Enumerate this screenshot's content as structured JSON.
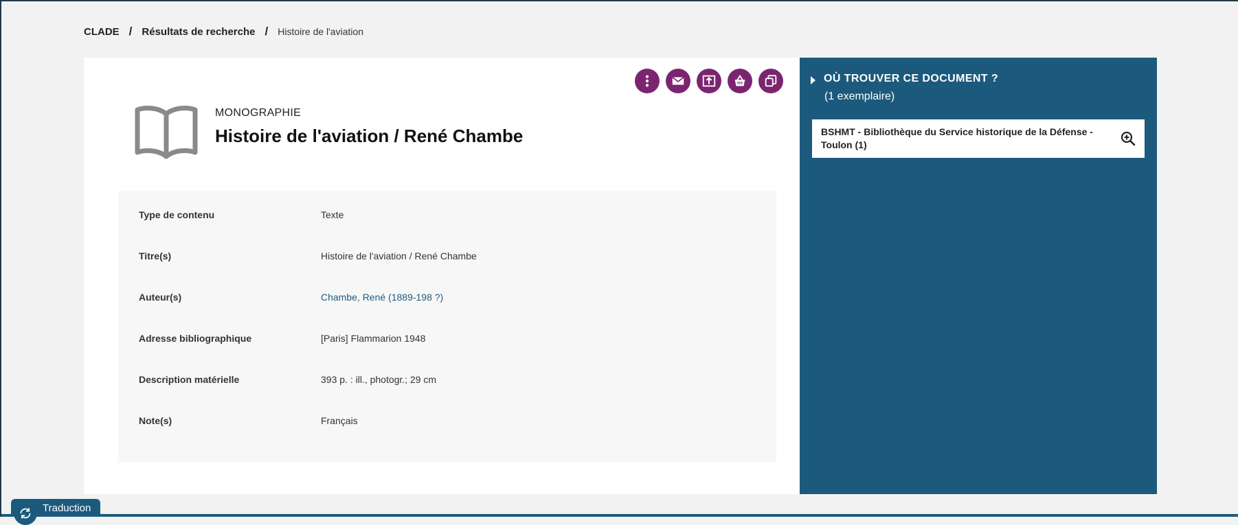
{
  "breadcrumb": {
    "home": "CLADE",
    "separator": "/",
    "results": "Résultats de recherche",
    "current": "Histoire de l'aviation"
  },
  "record": {
    "type": "MONOGRAPHIE",
    "title": "Histoire de l'aviation / René Chambe",
    "icon": "book-icon",
    "actions": [
      "more-options-icon",
      "email-icon",
      "export-icon",
      "basket-icon",
      "copy-icon"
    ]
  },
  "details": [
    {
      "label": "Type de contenu",
      "value": "Texte"
    },
    {
      "label": "Titre(s)",
      "value": "Histoire de l'aviation / René Chambe"
    },
    {
      "label": "Auteur(s)",
      "value": "Chambe, René (1889-198 ?)"
    },
    {
      "label": "Adresse bibliographique",
      "value": "[Paris] Flammarion 1948"
    },
    {
      "label": "Description matérielle",
      "value": "393 p. : ill., photogr.; 29 cm"
    },
    {
      "label": "Note(s)",
      "value": "Français"
    }
  ],
  "availability": {
    "heading": "OÙ TROUVER CE DOCUMENT ?",
    "count": "(1 exemplaire)",
    "location": "BSHMT - Bibliothèque du Service historique de la Défense - Toulon (1)"
  },
  "footer": {
    "translate_label": "Traduction"
  },
  "colors": {
    "accent": "#7b2470",
    "panel": "#1c5a7d",
    "link": "#1d5b80"
  }
}
